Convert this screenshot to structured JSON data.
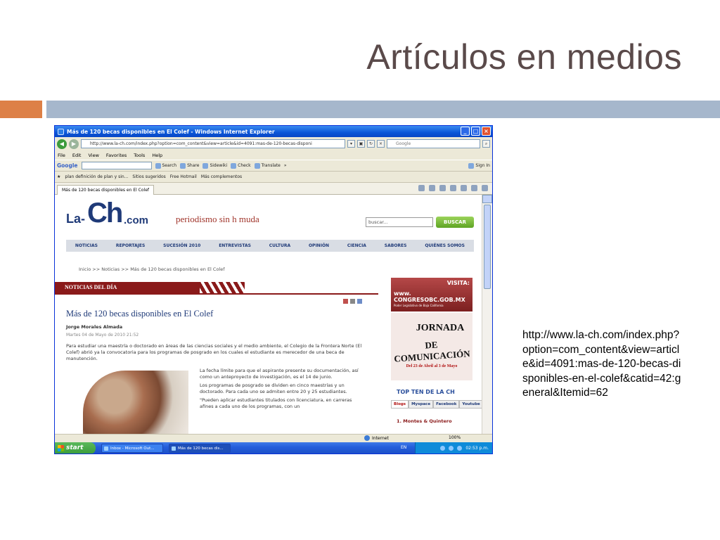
{
  "slide": {
    "title": "Artículos en medios",
    "url_text": "http://www.la-ch.com/index.php?option=com_content&view=article&id=4091:mas-de-120-becas-disponibles-en-el-colef&catid=42:general&Itemid=62",
    "accent_color": "#dd8047",
    "bar_color": "#a6b7cc"
  },
  "browser": {
    "window_title": "Más de 120 becas disponibles en El Colef - Windows Internet Explorer",
    "address": "http://www.la-ch.com/index.php?option=com_content&view=article&id=4091:mas-de-120-becas-disponi",
    "search_placeholder": "Google",
    "menu": [
      "File",
      "Edit",
      "View",
      "Favorites",
      "Tools",
      "Help"
    ],
    "toolbar": {
      "google": "Google",
      "search": "Search",
      "share": "Share",
      "sidewiki": "Sidewiki",
      "check": "Check",
      "translate": "Translate",
      "more": "»",
      "sign_in": "Sign In"
    },
    "favorites": {
      "fav1": "plan  definición de plan y sin...",
      "fav2": "Sitios sugeridos",
      "fav3": "Free Hotmail",
      "fav4": "Más complementos"
    },
    "tab_label": "Más de 120 becas disponibles en El Colef",
    "status": {
      "zone": "Internet",
      "zoom": "100%"
    }
  },
  "site": {
    "logo_la": "La-",
    "logo_ch": "Ch",
    "logo_com": ".com",
    "slogan": "periodismo sin h muda",
    "search_placeholder": "buscar...",
    "search_button": "BUSCAR",
    "nav": [
      "NOTICIAS",
      "REPORTAJES",
      "SUCESIÓN 2010",
      "ENTREVISTAS",
      "CULTURA",
      "OPINIÓN",
      "CIENCIA",
      "SABORES",
      "QUIÉNES SOMOS"
    ],
    "breadcrumb": "Inicio  >>  Noticias  >>  Más de 120 becas disponibles en El Colef",
    "section": "NOTICIAS DEL DÍA",
    "article": {
      "title": "Más de 120 becas disponibles en El Colef",
      "author": "Jorge Morales Almada",
      "date": "Martes 04 de Mayo de 2010 21:52",
      "p1": "Para estudiar una maestría o doctorado en áreas de las ciencias sociales y el medio ambiente, el Colegio de la Frontera Norte (El Colef) abrió ya la convocatoria para los programas de posgrado en los cuales el estudiante es merecedor de una beca de manutención.",
      "p2": "La fecha límite para que el aspirante presente su documentación, así como un anteproyecto de investigación, es el 14 de junio.",
      "p3": "Los programas de posgrado se dividen en cinco maestrías y un doctorado. Para cada uno se admiten entre 20 y 25 estudiantes.",
      "p4": "\"Pueden aplicar estudiantes titulados con licenciatura, en carreras afines a cada uno de los programas, con un"
    },
    "ad1": {
      "visita": "VISITA:",
      "url": "www. CONGRESOBC.GOB.MX",
      "sub": "Poder Legislativo de Baja California"
    },
    "ad2": {
      "line1": "JORNADA",
      "line2": "DE COMUNICACIÓN",
      "line3": "Del 23 de Abril al 3 de Mayo"
    },
    "topten": "TOP TEN DE LA CH",
    "blog_tabs": [
      "Blogs",
      "Myspace",
      "Facebook",
      "Youtube"
    ],
    "ranking_first": "1.  Montes & Quintero"
  },
  "taskbar": {
    "start": "start",
    "task1": "Inbox - Microsoft Out...",
    "task2": "Más de 120 becas dis...",
    "lang": "EN",
    "time": "02:53 p.m."
  }
}
